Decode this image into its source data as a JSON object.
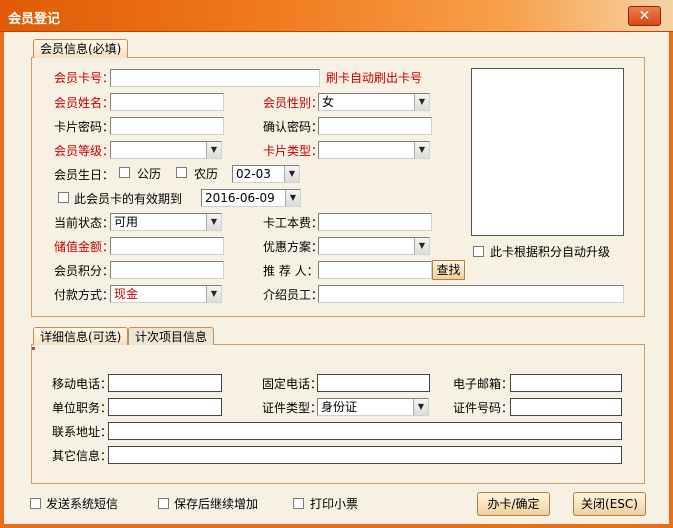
{
  "window": {
    "title": "会员登记",
    "close_glyph": "✕"
  },
  "tabs": {
    "member_info": "会员信息(必填)",
    "detail_info": "详细信息(可选)",
    "count_items": "计次项目信息"
  },
  "member": {
    "card_no_label": "会员卡号：",
    "card_hint": "刷卡自动刷出卡号",
    "name_label": "会员姓名：",
    "gender_label": "会员性别：",
    "gender_value": "女",
    "card_pwd_label": "卡片密码：",
    "confirm_pwd_label": "确认密码：",
    "level_label": "会员等级：",
    "card_type_label": "卡片类型：",
    "birthday_label": "会员生日：",
    "solar_label": "公历",
    "lunar_label": "农历",
    "birthday_value": "02-03",
    "expiry_label": "此会员卡的有效期到",
    "expiry_value": "2016-06-09",
    "status_label": "当前状态：",
    "status_value": "可用",
    "card_fee_label": "卡工本费：",
    "stored_value_label": "储值金额：",
    "discount_label": "优惠方案：",
    "points_label": "会员积分：",
    "referrer_label": "推 荐 人：",
    "find_button": "查找",
    "payment_label": "付款方式：",
    "payment_value": "现金",
    "introducer_label": "介绍员工：",
    "auto_upgrade_label": "此卡根据积分自动升级"
  },
  "detail": {
    "mobile_label": "移动电话：",
    "phone_label": "固定电话：",
    "email_label": "电子邮箱：",
    "job_label": "单位职务：",
    "id_type_label": "证件类型：",
    "id_type_value": "身份证",
    "id_no_label": "证件号码：",
    "address_label": "联系地址：",
    "other_label": "其它信息："
  },
  "footer": {
    "send_sms_label": "发送系统短信",
    "continue_label": "保存后继续增加",
    "print_label": "打印小票",
    "confirm_button": "办卡/确定",
    "close_button": "关闭(ESC)"
  },
  "colors": {
    "accent": "#e8701a",
    "required_label": "#c40000",
    "panel_bg": "#f6f1e3"
  },
  "icons": {
    "dropdown": "chevron-down-icon",
    "close": "close-icon"
  }
}
